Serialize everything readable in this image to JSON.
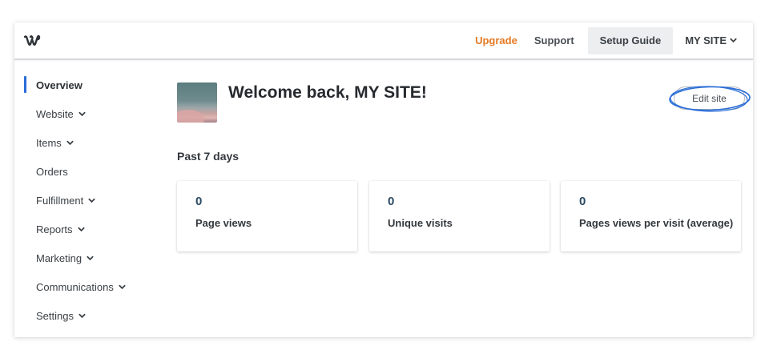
{
  "header": {
    "logo_icon": "weebly-w-logo-icon",
    "upgrade_label": "Upgrade",
    "support_label": "Support",
    "setup_guide_label": "Setup Guide",
    "site_menu_label": "MY SITE",
    "accent_color": "#e47a24"
  },
  "sidebar": {
    "items": [
      {
        "label": "Overview",
        "active": true,
        "has_submenu": false
      },
      {
        "label": "Website",
        "active": false,
        "has_submenu": true
      },
      {
        "label": "Items",
        "active": false,
        "has_submenu": true
      },
      {
        "label": "Orders",
        "active": false,
        "has_submenu": false
      },
      {
        "label": "Fulfillment",
        "active": false,
        "has_submenu": true
      },
      {
        "label": "Reports",
        "active": false,
        "has_submenu": true
      },
      {
        "label": "Marketing",
        "active": false,
        "has_submenu": true
      },
      {
        "label": "Communications",
        "active": false,
        "has_submenu": true
      },
      {
        "label": "Settings",
        "active": false,
        "has_submenu": true
      }
    ],
    "active_color": "#2a6bd9"
  },
  "main": {
    "welcome_title": "Welcome back, MY SITE!",
    "edit_site_label": "Edit site",
    "period_label": "Past 7 days",
    "stats": [
      {
        "value": "0",
        "label": "Page views"
      },
      {
        "value": "0",
        "label": "Unique visits"
      },
      {
        "value": "0",
        "label": "Pages views per visit (average)"
      }
    ]
  }
}
